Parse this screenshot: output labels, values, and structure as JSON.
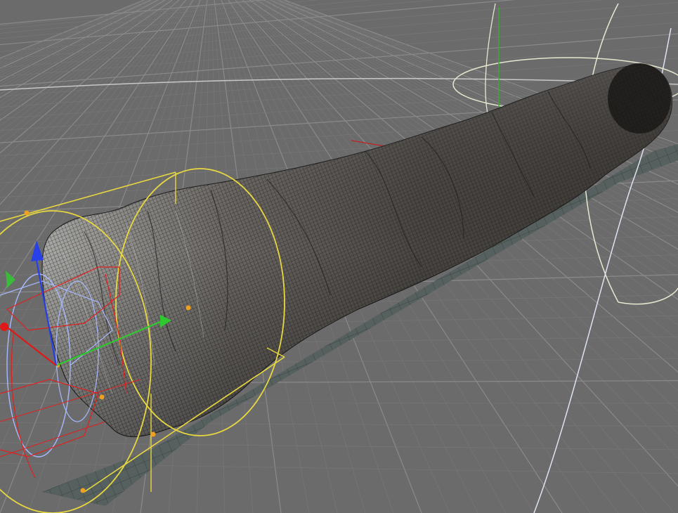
{
  "viewport": {
    "background_color": "#6b6b6b",
    "grid_color": "#8a8a8a",
    "grid_minor_color": "#777777",
    "horizon_line_color": "#b8b8b8"
  },
  "scene": {
    "mesh_object": "rock-tube-mesh",
    "mesh_wireframe_color": "#1a1a1a",
    "mesh_base_color": "#5a5652",
    "ground_shadow_color": "#55605e",
    "selection_cage_color": "#e8d840",
    "spline_color_white": "#e8e8d8",
    "spline_color_blue": "#a8b8ff",
    "spline_color_red": "#e02020"
  },
  "gizmo": {
    "axis_x_color": "#e01818",
    "axis_y_color": "#30c830",
    "axis_z_color": "#2840e8",
    "handle_color": "#f0a020",
    "icons": [
      "move-gizmo-icon",
      "axis-arrow-x-icon",
      "axis-arrow-y-icon",
      "axis-arrow-z-icon"
    ]
  }
}
